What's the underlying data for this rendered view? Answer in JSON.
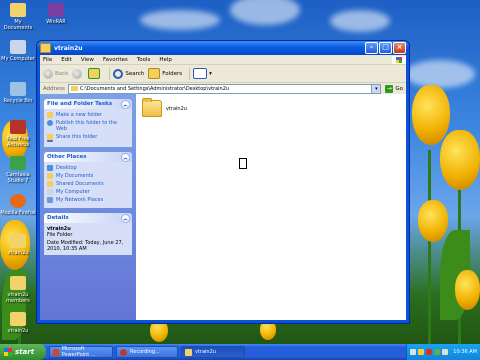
{
  "desktop": {
    "icons": [
      {
        "label": "My Documents",
        "color": "#f2d26b"
      },
      {
        "label": "WinRAR",
        "color": "#7b3fa1"
      },
      {
        "label": "My Computer",
        "color": "#c9d6e8"
      },
      {
        "label": "Recycle Bin",
        "color": "#9cc3e6"
      },
      {
        "label": "Real Free Antivirus",
        "color": "#b6332b"
      },
      {
        "label": "Camtasia Studio 7",
        "color": "#3aa24a"
      },
      {
        "label": "Mozilla Firefox",
        "color": "#e56a1c"
      },
      {
        "label": "vtrain2u",
        "color": "#f2d26b"
      },
      {
        "label": "vtrain2u members",
        "color": "#f2d26b"
      },
      {
        "label": "vtrain2u",
        "color": "#f2d26b"
      }
    ]
  },
  "window": {
    "title": "vtrain2u",
    "menu": [
      "File",
      "Edit",
      "View",
      "Favorites",
      "Tools",
      "Help"
    ],
    "toolbar": {
      "back": "Back",
      "search": "Search",
      "folders": "Folders"
    },
    "address": {
      "label": "Address",
      "path": "C:\\Documents and Settings\\Administrator\\Desktop\\vtrain2u",
      "go": "Go"
    }
  },
  "taskpane": {
    "file_tasks": {
      "title": "File and Folder Tasks",
      "items": [
        "Make a new folder",
        "Publish this folder to the Web",
        "Share this folder"
      ]
    },
    "other_places": {
      "title": "Other Places",
      "items": [
        "Desktop",
        "My Documents",
        "Shared Documents",
        "My Computer",
        "My Network Places"
      ]
    },
    "details": {
      "title": "Details",
      "name": "vtrain2u",
      "type": "File Folder",
      "modified": "Date Modified: Today, June 27, 2010, 10:35 AM"
    }
  },
  "content": {
    "files": [
      {
        "name": "vtrain2u"
      }
    ]
  },
  "taskbar": {
    "start": "start",
    "tasks": [
      {
        "label": "Microsoft PowerPoint ...",
        "color": "#d24726",
        "active": false
      },
      {
        "label": "Recording...",
        "color": "#c0392b",
        "active": false
      },
      {
        "label": "vtrain2u",
        "color": "#f2d26b",
        "active": true
      }
    ],
    "time": "10:36 AM"
  }
}
